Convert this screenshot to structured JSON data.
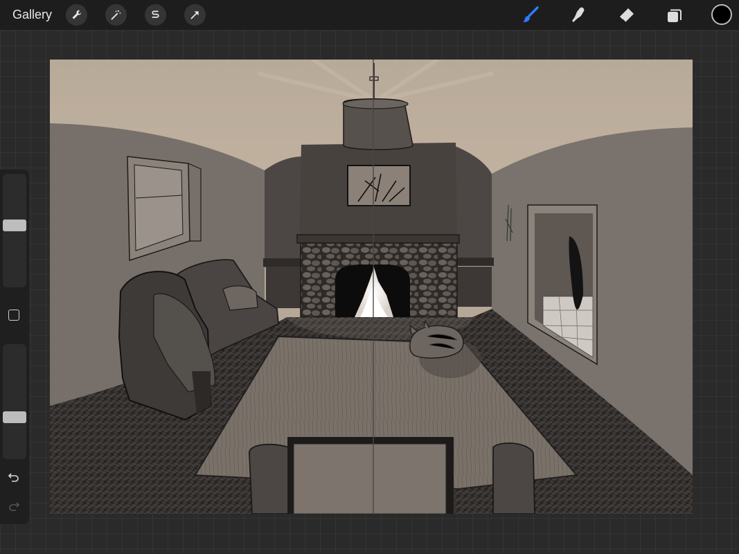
{
  "topbar": {
    "gallery_label": "Gallery",
    "left_tools": [
      {
        "name": "actions",
        "icon": "wrench-icon"
      },
      {
        "name": "adjustments",
        "icon": "magic-wand-icon"
      },
      {
        "name": "selection",
        "icon": "selection-s-icon"
      },
      {
        "name": "transform",
        "icon": "arrow-cursor-icon"
      }
    ],
    "right_tools": [
      {
        "name": "brush",
        "icon": "brush-icon",
        "active": true
      },
      {
        "name": "smudge",
        "icon": "smudge-finger-icon",
        "active": false
      },
      {
        "name": "eraser",
        "icon": "eraser-icon",
        "active": false
      },
      {
        "name": "layers",
        "icon": "layers-icon",
        "active": false
      }
    ],
    "current_color": "#000000"
  },
  "sidebar": {
    "brush_size_level": 0.55,
    "opacity_level": 0.35,
    "modify_icon": "square-icon",
    "undo_icon": "undo-icon",
    "redo_icon": "redo-icon"
  },
  "colors": {
    "active_tool": "#2e7bff",
    "canvas_background": "#b6a898",
    "app_background": "#2a2a2a"
  }
}
